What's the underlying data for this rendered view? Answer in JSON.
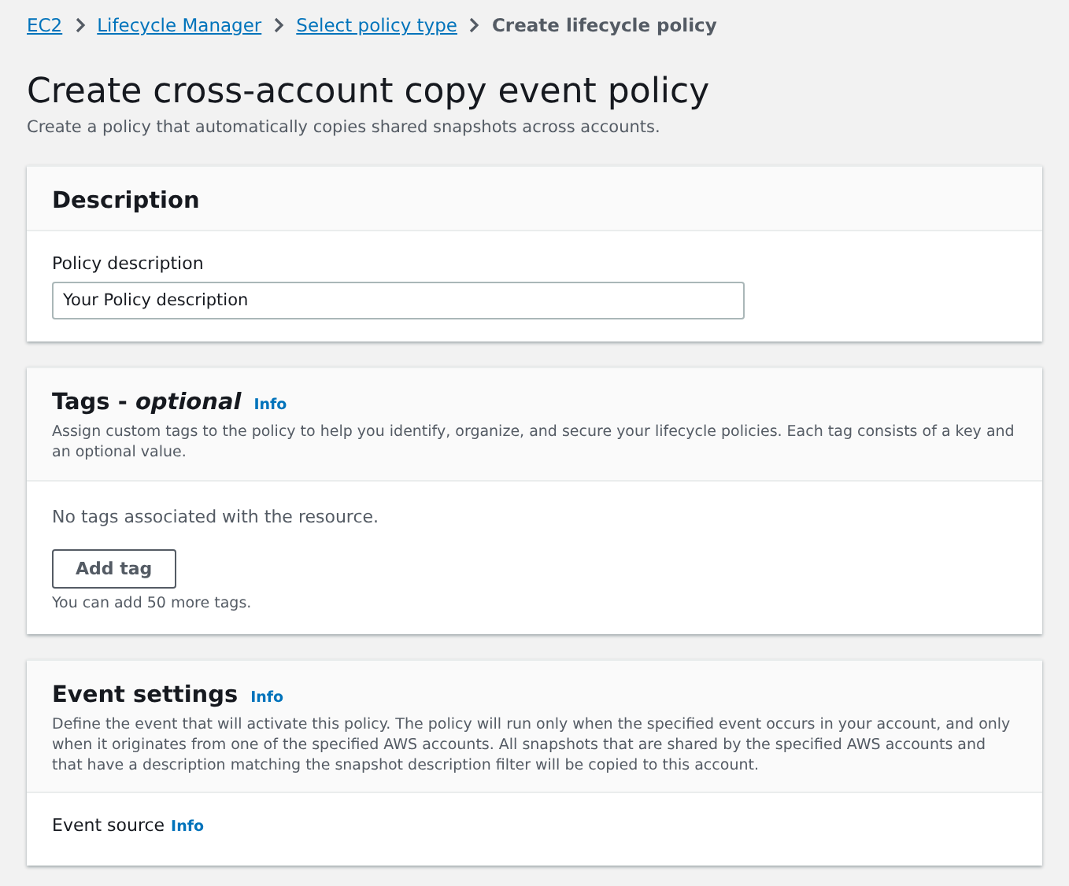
{
  "breadcrumbs": [
    {
      "label": "EC2",
      "kind": "link"
    },
    {
      "label": "Lifecycle Manager",
      "kind": "link"
    },
    {
      "label": "Select policy type",
      "kind": "link"
    },
    {
      "label": "Create lifecycle policy",
      "kind": "current"
    }
  ],
  "page": {
    "title": "Create cross-account copy event policy",
    "subtitle": "Create a policy that automatically copies shared snapshots across accounts."
  },
  "sections": [
    {
      "title": "Description",
      "fields": [
        {
          "kind": "input",
          "label": "Policy description",
          "value": "Your Policy description"
        }
      ]
    },
    {
      "title": "Tags - *optional*",
      "info": "Info",
      "description": "Assign custom tags to the policy to help you identify, organize, and secure your lifecycle policies. Each tag consists of a key and an optional value.",
      "fields": [
        {
          "kind": "tags",
          "empty_text": "No tags associated with the resource.",
          "button": "Add tag",
          "hint": "You can add 50 more tags."
        }
      ]
    },
    {
      "title": "Event settings",
      "info": "Info",
      "description": "Define the event that will activate this policy. The policy will run only when the specified event occurs in your account, and only when it originates from one of the specified AWS accounts. All snapshots that are shared by the specified AWS accounts and that have a description matching the snapshot description filter will be copied to this account.",
      "fields": [
        {
          "kind": "label",
          "label": "Event source",
          "info": "Info"
        }
      ]
    }
  ]
}
